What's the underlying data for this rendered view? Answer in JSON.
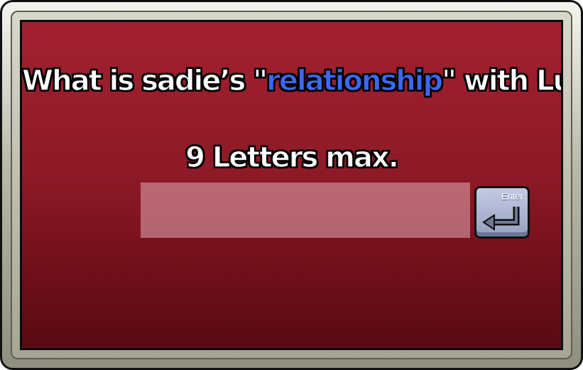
{
  "question": {
    "before": "What is sadie’s \"",
    "highlight": "relationship",
    "after": "\"  with Lucas?"
  },
  "hint": "9 Letters max.",
  "answer_input": {
    "value": "",
    "placeholder": "",
    "maxlength": "9"
  },
  "enter_button": {
    "label": "Enter",
    "icon": "enter-arrow-icon"
  },
  "colors": {
    "panel": "#9a1d2c",
    "highlight": "#3c68f0",
    "input_fill": "#c9858e",
    "key": "#aeb6d2"
  }
}
